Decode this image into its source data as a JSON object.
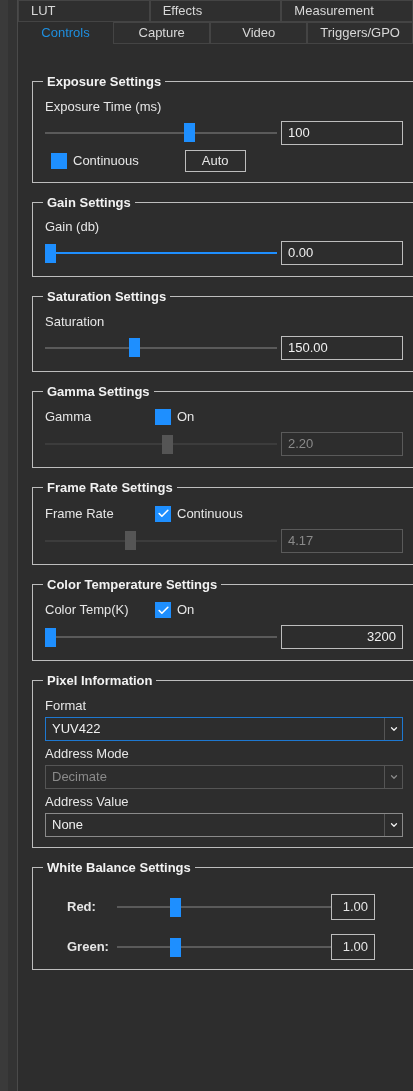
{
  "tabs": [
    [
      {
        "label": "LUT",
        "selected": false
      },
      {
        "label": "Effects",
        "selected": false
      },
      {
        "label": "Measurement",
        "selected": false
      }
    ],
    [
      {
        "label": "Controls",
        "selected": true
      },
      {
        "label": "Capture",
        "selected": false
      },
      {
        "label": "Video",
        "selected": false
      },
      {
        "label": "Triggers/GPO",
        "selected": false
      }
    ]
  ],
  "sections": [
    {
      "title": "Exposure Settings",
      "items": [
        {
          "kind": "label",
          "text": "Exposure Time (ms)"
        },
        {
          "kind": "slider",
          "level": 0.63,
          "value": "100",
          "disabled": false,
          "focused": false,
          "right_aligned": false
        },
        {
          "kind": "options",
          "checkbox": {
            "label": "Continuous",
            "checked": true,
            "kind": "fill"
          },
          "button": "Auto"
        }
      ]
    },
    {
      "title": "Gain Settings",
      "items": [
        {
          "kind": "label",
          "text": "Gain (db)"
        },
        {
          "kind": "slider",
          "level": 0,
          "value": "0.00",
          "disabled": false,
          "focused": true,
          "right_aligned": false
        }
      ]
    },
    {
      "title": "Saturation Settings",
      "items": [
        {
          "kind": "label",
          "text": "Saturation"
        },
        {
          "kind": "slider",
          "level": 0.38,
          "value": "150.00",
          "disabled": false,
          "focused": false,
          "right_aligned": false
        }
      ]
    },
    {
      "title": "Gamma Settings",
      "items": [
        {
          "kind": "label_check",
          "text": "Gamma",
          "checkbox": {
            "label": "On",
            "checked": true,
            "kind": "fill"
          }
        },
        {
          "kind": "slider",
          "level": 0.53,
          "value": "2.20",
          "disabled": true,
          "focused": false,
          "right_aligned": false
        }
      ]
    },
    {
      "title": "Frame Rate Settings",
      "items": [
        {
          "kind": "label_check",
          "text": "Frame Rate",
          "checkbox": {
            "label": "Continuous",
            "checked": true,
            "kind": "tick"
          }
        },
        {
          "kind": "slider",
          "level": 0.36,
          "value": "4.17",
          "disabled": true,
          "focused": false,
          "right_aligned": false
        }
      ]
    },
    {
      "title": "Color Temperature Settings",
      "items": [
        {
          "kind": "label_check",
          "text": "Color Temp(K)",
          "checkbox": {
            "label": "On",
            "checked": true,
            "kind": "tick"
          }
        },
        {
          "kind": "slider",
          "level": 0,
          "value": "3200",
          "disabled": false,
          "focused": false,
          "right_aligned": true
        }
      ]
    },
    {
      "title": "Pixel Information",
      "items": [
        {
          "kind": "label",
          "text": "Format"
        },
        {
          "kind": "dropdown",
          "value": "YUV422",
          "disabled": false,
          "focused": true
        },
        {
          "kind": "label",
          "text": "Address Mode"
        },
        {
          "kind": "dropdown",
          "value": "Decimate",
          "disabled": true,
          "focused": false
        },
        {
          "kind": "label",
          "text": "Address Value"
        },
        {
          "kind": "dropdown",
          "value": "None",
          "disabled": false,
          "focused": false
        }
      ]
    },
    {
      "title": "White Balance Settings",
      "items": [
        {
          "kind": "named_slider",
          "text": "Red:",
          "level": 0.26,
          "value": "1.00"
        },
        {
          "kind": "named_slider",
          "text": "Green:",
          "level": 0.26,
          "value": "1.00"
        }
      ]
    }
  ]
}
